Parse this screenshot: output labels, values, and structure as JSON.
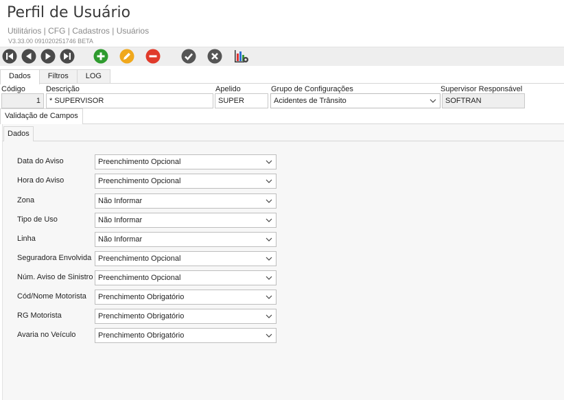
{
  "header": {
    "title": "Perfil de Usuário",
    "breadcrumb": "Utilitários | CFG | Cadastros | Usuários",
    "version": "V3.33.00 091020251746 BETA"
  },
  "toolbar": {
    "buttons": [
      "first-record",
      "previous-record",
      "next-record",
      "last-record",
      "add",
      "edit",
      "delete",
      "confirm",
      "cancel",
      "report-settings"
    ],
    "colors": {
      "nav": "#4a4a4a",
      "add": "#2e9b2e",
      "edit": "#f0a81c",
      "delete": "#e03a2a",
      "confirm": "#555555",
      "cancel": "#555555"
    }
  },
  "tabs": [
    "Dados",
    "Filtros",
    "LOG"
  ],
  "form": {
    "codigo_label": "Código",
    "codigo_value": "1",
    "descricao_label": "Descrição",
    "descricao_value": "* SUPERVISOR",
    "apelido_label": "Apelido",
    "apelido_value": "SUPER",
    "grupo_label": "Grupo de Configurações",
    "grupo_value": "Acidentes de Trânsito",
    "supervisor_label": "Supervisor Responsável",
    "supervisor_value": "SOFTRAN"
  },
  "subtab": "Validação de Campos",
  "inner_tab": "Dados",
  "fields": [
    {
      "label": "Data do Aviso",
      "value": "Preenchimento Opcional"
    },
    {
      "label": "Hora do Aviso",
      "value": "Preenchimento Opcional"
    },
    {
      "label": "Zona",
      "value": "Não Informar"
    },
    {
      "label": "Tipo de Uso",
      "value": "Não Informar"
    },
    {
      "label": "Linha",
      "value": "Não Informar"
    },
    {
      "label": "Seguradora Envolvida",
      "value": "Preenchimento Opcional"
    },
    {
      "label": "Núm. Aviso de Sinistro",
      "value": "Preenchimento Opcional"
    },
    {
      "label": "Cód/Nome Motorista",
      "value": "Prenchimento Obrigatório"
    },
    {
      "label": "RG Motorista",
      "value": "Prenchimento Obrigatório"
    },
    {
      "label": "Avaria no Veículo",
      "value": "Prenchimento Obrigatório"
    }
  ]
}
